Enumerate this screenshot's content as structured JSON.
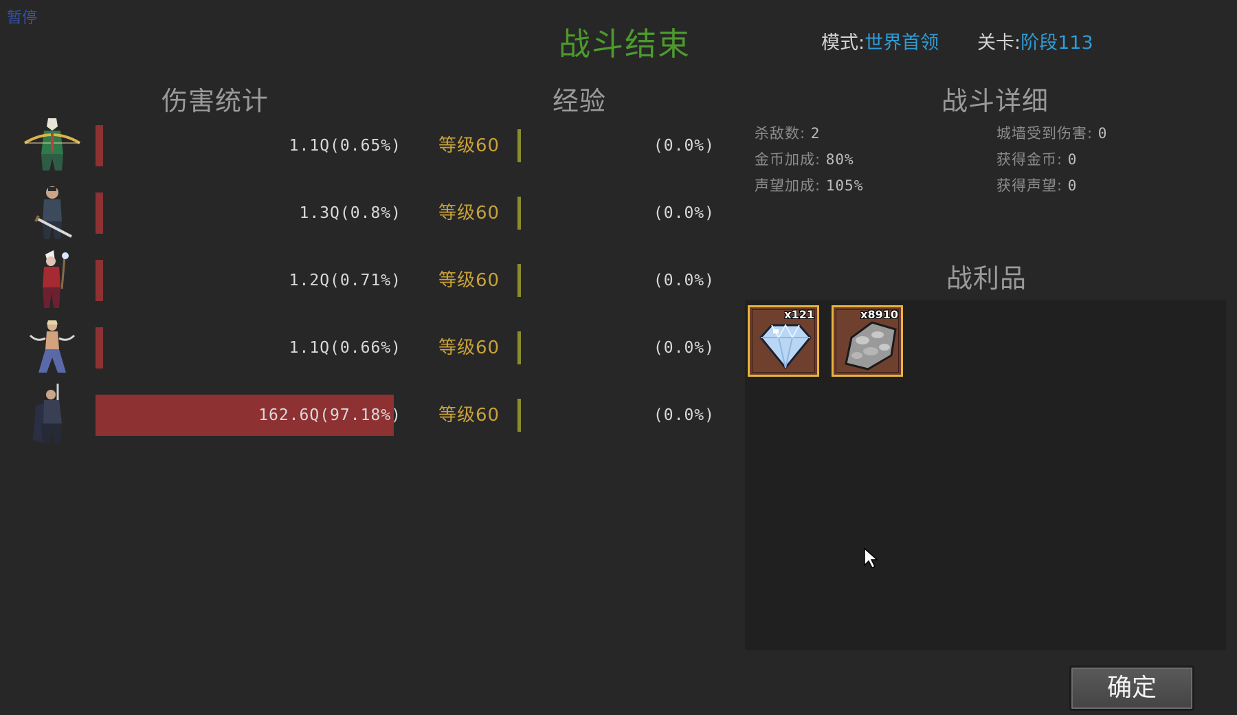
{
  "pause_label": "暂停",
  "title": "战斗结束",
  "mode": {
    "label": "模式:",
    "value": "世界首领"
  },
  "stage": {
    "label": "关卡:",
    "value": "阶段113"
  },
  "headers": {
    "damage": "伤害统计",
    "exp": "经验",
    "details": "战斗详细",
    "loot": "战利品"
  },
  "heroes": [
    {
      "portrait": "archer-hero-icon",
      "damage": "1.1Q(0.65%)",
      "damage_share": 0.0065,
      "level": "等级60",
      "exp": "(0.0%)"
    },
    {
      "portrait": "swordsman-hero-icon",
      "damage": "1.3Q(0.8%)",
      "damage_share": 0.008,
      "level": "等级60",
      "exp": "(0.0%)"
    },
    {
      "portrait": "mage-hero-icon",
      "damage": "1.2Q(0.71%)",
      "damage_share": 0.0071,
      "level": "等级60",
      "exp": "(0.0%)"
    },
    {
      "portrait": "dancer-hero-icon",
      "damage": "1.1Q(0.66%)",
      "damage_share": 0.0066,
      "level": "等级60",
      "exp": "(0.0%)"
    },
    {
      "portrait": "knight-hero-icon",
      "damage": "162.6Q(97.18%)",
      "damage_share": 0.9718,
      "level": "等级60",
      "exp": "(0.0%)"
    }
  ],
  "details": {
    "kills": {
      "label": "杀敌数:",
      "value": "2"
    },
    "wall_damage": {
      "label": "城墙受到伤害:",
      "value": "0"
    },
    "gold_bonus": {
      "label": "金币加成:",
      "value": "80%"
    },
    "gold_gained": {
      "label": "获得金币:",
      "value": "0"
    },
    "fame_bonus": {
      "label": "声望加成:",
      "value": "105%"
    },
    "fame_gained": {
      "label": "获得声望:",
      "value": "0"
    }
  },
  "loot": [
    {
      "icon": "diamond-icon",
      "count": "x121"
    },
    {
      "icon": "stone-ore-icon",
      "count": "x8910"
    }
  ],
  "confirm_label": "确定",
  "colors": {
    "background": "#272727",
    "title": "#4c9a2d",
    "accent_blue": "#2f9bd4",
    "damage_bar": "#8d3133",
    "level_text": "#c8a13a",
    "exp_bar": "#8a8d2d",
    "loot_border": "#e8b43a"
  }
}
